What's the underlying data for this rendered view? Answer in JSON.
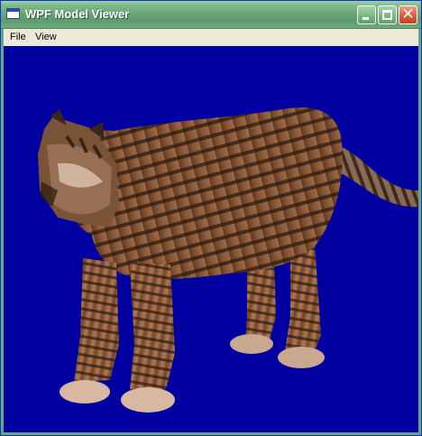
{
  "window": {
    "title": "WPF Model Viewer"
  },
  "titlebar_buttons": {
    "minimize_icon": "minimize-icon",
    "maximize_icon": "maximize-icon",
    "close_icon": "close-icon",
    "close_glyph": "✕"
  },
  "menu": {
    "items": [
      "File",
      "View"
    ]
  },
  "viewport": {
    "background_color": "#0000a0",
    "model": "tiger-3d-model"
  }
}
